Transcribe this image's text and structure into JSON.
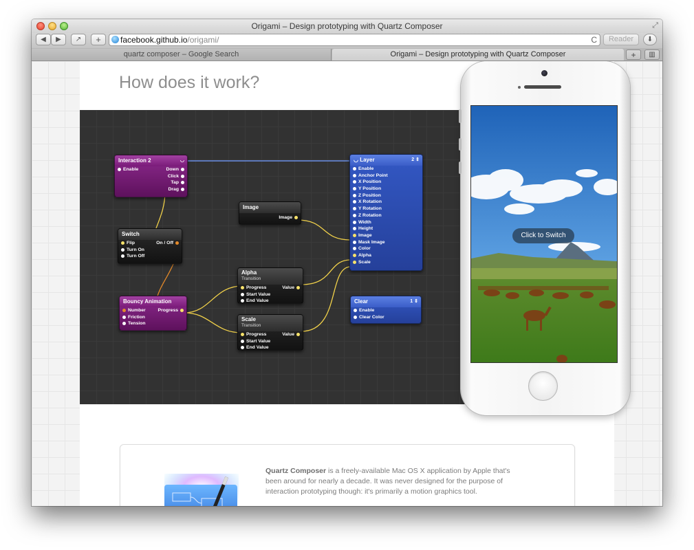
{
  "window": {
    "title": "Origami – Design prototyping with Quartz Composer",
    "url_host": "facebook.github.io",
    "url_path": "/origami/",
    "reader_label": "Reader"
  },
  "tabs": [
    {
      "label": "quartz composer – Google Search"
    },
    {
      "label": "Origami – Design prototyping with Quartz Composer"
    }
  ],
  "toolbar_icons": {
    "back": "◀",
    "forward": "▶",
    "share": "↗",
    "add": "+",
    "reload": "C",
    "download": "⬇",
    "new_tab": "+",
    "tab_list": "▥",
    "fullscreen": "⤢"
  },
  "page": {
    "heading": "How does it work?",
    "phone_button": "Click to Switch",
    "info_title": "Quartz Composer",
    "info_body": " is a freely-available Mac OS X application by Apple that's been around for nearly a decade. It was never designed for the purpose of interaction prototyping though: it's primarily a motion graphics tool."
  },
  "colors": {
    "wire": "#f2d24a",
    "wire_blue": "#6a8fe8",
    "wire_orange": "#e3892a",
    "purple_node": "#7a1b79",
    "blue_node": "#3b5ec8",
    "canvas_bg": "#323232"
  },
  "nodes": {
    "interaction": {
      "title": "Interaction 2",
      "head_right": "◡",
      "inputs": [
        "Enable"
      ],
      "outputs": [
        "Down",
        "Click",
        "Tap",
        "Drag"
      ]
    },
    "switch": {
      "title": "Switch",
      "inputs": [
        "Flip",
        "Turn On",
        "Turn Off"
      ],
      "outputs": [
        "On / Off"
      ]
    },
    "bouncy": {
      "title": "Bouncy Animation",
      "inputs": [
        "Number",
        "Friction",
        "Tension"
      ],
      "outputs": [
        "Progress"
      ]
    },
    "image": {
      "title": "Image",
      "outputs": [
        "Image"
      ]
    },
    "alpha": {
      "title": "Alpha",
      "subtitle": "Transition",
      "inputs": [
        "Progress",
        "Start Value",
        "End Value"
      ],
      "outputs": [
        "Value"
      ]
    },
    "scale": {
      "title": "Scale",
      "subtitle": "Transition",
      "inputs": [
        "Progress",
        "Start Value",
        "End Value"
      ],
      "outputs": [
        "Value"
      ]
    },
    "layer": {
      "title": "Layer",
      "head_left": "◡",
      "head_right": "2 ⇕",
      "inputs": [
        "Enable",
        "Anchor Point",
        "X Position",
        "Y Position",
        "Z Position",
        "X Rotation",
        "Y Rotation",
        "Z Rotation",
        "Width",
        "Height",
        "Image",
        "Mask Image",
        "Color",
        "Alpha",
        "Scale"
      ]
    },
    "clear": {
      "title": "Clear",
      "head_right": "1 ⇕",
      "inputs": [
        "Enable",
        "Clear Color"
      ]
    }
  }
}
